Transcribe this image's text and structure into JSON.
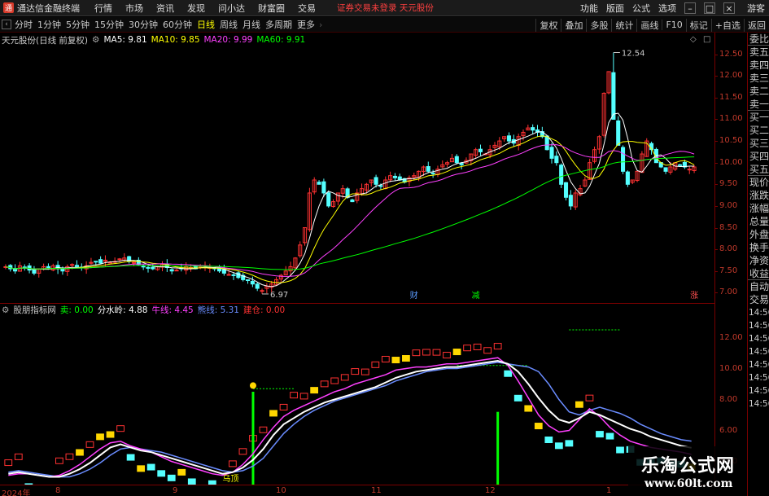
{
  "app": {
    "title": "通达信金融终端",
    "logo_text": "通"
  },
  "menu": [
    "行情",
    "市场",
    "资讯",
    "发现",
    "问小达",
    "财富圈",
    "交易"
  ],
  "warning": "证券交易未登录  天元股份",
  "menu_right": [
    "功能",
    "版面",
    "公式",
    "选项"
  ],
  "guest": "游客",
  "toolbar": {
    "periods": [
      "分时",
      "1分钟",
      "5分钟",
      "15分钟",
      "30分钟",
      "60分钟",
      "日线",
      "周线",
      "月线",
      "多周期",
      "更多"
    ],
    "active": "日线",
    "more_arrow": "›",
    "right_buttons": [
      "复权",
      "叠加",
      "多股",
      "统计",
      "画线",
      "F10",
      "标记",
      "+自选",
      "返回"
    ]
  },
  "main_info": {
    "stock": "天元股份(日线 前复权)",
    "ma5": "MA5: 9.81",
    "ma10": "MA10: 9.85",
    "ma20": "MA20: 9.99",
    "ma60": "MA60: 9.91"
  },
  "main_annotations": {
    "high": "12.54",
    "low": "6.97",
    "tag1": "财",
    "tag2": "减",
    "tag3": "涨"
  },
  "sub_info": {
    "name": "股朋指标网",
    "sell": "卖: 0.00",
    "watershed": "分水岭: 4.88",
    "bull": "牛线: 4.45",
    "bear": "熊线: 5.31",
    "build": "建仓: 0.00"
  },
  "sub_annotations": {
    "wuding": "乌顶"
  },
  "right_panel": {
    "items": [
      "委比",
      "卖五",
      "卖四",
      "卖三",
      "卖二",
      "卖一",
      "买一",
      "买二",
      "买三",
      "买四",
      "买五",
      "现价",
      "涨跌",
      "涨幅",
      "总量",
      "外盘",
      "换手",
      "净资",
      "收益",
      "自动",
      "交易"
    ],
    "times": [
      "14:56",
      "14:56",
      "14:56",
      "14:56",
      "14:56",
      "14:56",
      "14:56",
      "14:56"
    ]
  },
  "main_axis": [
    "12.50",
    "12.00",
    "11.50",
    "11.00",
    "10.50",
    "10.00",
    "9.50",
    "9.00",
    "8.50",
    "8.00",
    "7.50",
    "7.00"
  ],
  "sub_axis": [
    "12.00",
    "10.00",
    "8.00",
    "6.00",
    "4.00"
  ],
  "date_axis": [
    "2024年",
    "8",
    "9",
    "10",
    "11",
    "12",
    "1"
  ],
  "watermark": {
    "cn": "乐淘公式网",
    "url": "www.60lt.com"
  },
  "colors": {
    "up": "#ff3232",
    "down": "#54ffff",
    "ma5": "#ffffff",
    "ma10": "#ffff00",
    "ma20": "#ff40ff",
    "ma60": "#00ff00",
    "axis": "#7a0000"
  },
  "chart_data": [
    {
      "type": "candlestick",
      "title": "天元股份(日线 前复权)",
      "ylim": [
        6.8,
        12.7
      ],
      "x_ticks": [
        "2024年",
        "8",
        "9",
        "10",
        "11",
        "12",
        "1"
      ],
      "highest": 12.54,
      "lowest": 6.97,
      "close": [
        7.6,
        7.55,
        7.5,
        7.62,
        7.58,
        7.52,
        7.45,
        7.55,
        7.6,
        7.58,
        7.62,
        7.55,
        7.5,
        7.6,
        7.65,
        7.6,
        7.58,
        7.62,
        7.7,
        7.72,
        7.68,
        7.75,
        7.7,
        7.72,
        7.78,
        7.8,
        7.72,
        7.7,
        7.65,
        7.6,
        7.58,
        7.55,
        7.6,
        7.65,
        7.58,
        7.5,
        7.52,
        7.55,
        7.6,
        7.58,
        7.55,
        7.6,
        7.62,
        7.58,
        7.55,
        7.5,
        7.45,
        7.42,
        7.4,
        7.35,
        7.3,
        7.28,
        7.2,
        7.1,
        7.05,
        7.15,
        7.2,
        7.3,
        7.4,
        7.5,
        7.6,
        7.8,
        8.1,
        8.5,
        9.3,
        9.6,
        9.5,
        9.3,
        9.0,
        9.1,
        9.3,
        9.4,
        9.2,
        9.1,
        9.3,
        9.4,
        9.5,
        9.6,
        9.5,
        9.45,
        9.6,
        9.7,
        9.65,
        9.6,
        9.55,
        9.65,
        9.7,
        9.8,
        9.9,
        9.8,
        9.75,
        9.85,
        9.95,
        10.0,
        10.1,
        10.0,
        9.95,
        10.05,
        10.2,
        10.3,
        10.25,
        10.2,
        10.3,
        10.4,
        10.5,
        10.6,
        10.5,
        10.45,
        10.6,
        10.7,
        10.8,
        10.75,
        10.7,
        10.6,
        10.3,
        10.1,
        10.0,
        9.5,
        9.2,
        9.0,
        9.3,
        9.4,
        9.6,
        10.0,
        10.3,
        10.6,
        11.6,
        12.1,
        11.0,
        10.4,
        9.8,
        9.5,
        9.6,
        9.8,
        10.2,
        10.5,
        10.3,
        10.0,
        9.9,
        9.8,
        9.9,
        10.0,
        9.95,
        9.9,
        9.85,
        9.9
      ],
      "series": [
        {
          "name": "MA5",
          "values": [
            9.81
          ]
        },
        {
          "name": "MA10",
          "values": [
            9.85
          ]
        },
        {
          "name": "MA20",
          "values": [
            9.99
          ]
        },
        {
          "name": "MA60",
          "values": [
            9.91
          ]
        }
      ]
    },
    {
      "type": "line",
      "title": "股朋指标网",
      "ylim": [
        2.5,
        13.5
      ],
      "series": [
        {
          "name": "卖",
          "values": [
            0.0
          ]
        },
        {
          "name": "分水岭",
          "values": [
            3.2,
            3.3,
            3.2,
            3.1,
            3.0,
            3.0,
            3.2,
            3.5,
            3.9,
            4.4,
            4.9,
            5.1,
            4.9,
            4.7,
            4.6,
            4.4,
            4.2,
            4.0,
            3.8,
            3.6,
            3.4,
            3.2,
            3.3,
            3.6,
            4.1,
            4.8,
            5.7,
            6.4,
            6.8,
            7.2,
            7.5,
            7.8,
            8.0,
            8.2,
            8.4,
            8.6,
            8.8,
            9.1,
            9.4,
            9.6,
            9.8,
            9.9,
            10.0,
            10.1,
            10.1,
            10.2,
            10.3,
            10.4,
            10.5,
            10.3,
            9.8,
            9.0,
            8.1,
            7.3,
            6.7,
            6.5,
            6.8,
            7.2,
            7.0,
            6.7,
            6.4,
            6.1,
            5.9,
            5.6,
            5.4,
            5.2,
            5.0,
            4.88
          ]
        },
        {
          "name": "牛线",
          "values": [
            3.1,
            3.2,
            3.2,
            3.1,
            3.0,
            3.1,
            3.4,
            3.8,
            4.3,
            4.8,
            5.2,
            5.3,
            5.0,
            4.8,
            4.6,
            4.3,
            4.0,
            3.8,
            3.6,
            3.4,
            3.2,
            3.1,
            3.3,
            3.8,
            4.5,
            5.4,
            6.2,
            6.9,
            7.3,
            7.6,
            7.9,
            8.2,
            8.5,
            8.7,
            9.0,
            9.2,
            9.4,
            9.6,
            9.9,
            10.0,
            10.1,
            10.1,
            10.2,
            10.3,
            10.3,
            10.4,
            10.5,
            10.6,
            10.7,
            10.2,
            9.2,
            8.1,
            7.0,
            6.3,
            5.9,
            6.0,
            6.7,
            7.4,
            6.9,
            6.2,
            5.7,
            5.3,
            5.1,
            4.9,
            4.8,
            4.7,
            4.6,
            4.45
          ]
        },
        {
          "name": "熊线",
          "values": [
            3.3,
            3.4,
            3.3,
            3.2,
            3.1,
            3.0,
            3.0,
            3.2,
            3.5,
            3.9,
            4.4,
            4.8,
            4.9,
            4.8,
            4.7,
            4.6,
            4.4,
            4.2,
            4.0,
            3.8,
            3.6,
            3.4,
            3.3,
            3.4,
            3.7,
            4.2,
            5.0,
            5.8,
            6.4,
            6.9,
            7.3,
            7.6,
            7.9,
            8.1,
            8.3,
            8.5,
            8.7,
            8.9,
            9.2,
            9.4,
            9.6,
            9.8,
            9.9,
            10.0,
            10.0,
            10.1,
            10.2,
            10.3,
            10.4,
            10.3,
            10.2,
            10.1,
            9.8,
            9.0,
            8.0,
            7.2,
            7.0,
            7.3,
            7.5,
            7.3,
            7.1,
            6.8,
            6.4,
            6.1,
            5.8,
            5.6,
            5.4,
            5.31
          ]
        },
        {
          "name": "建仓",
          "values": [
            0.0
          ]
        }
      ]
    }
  ]
}
